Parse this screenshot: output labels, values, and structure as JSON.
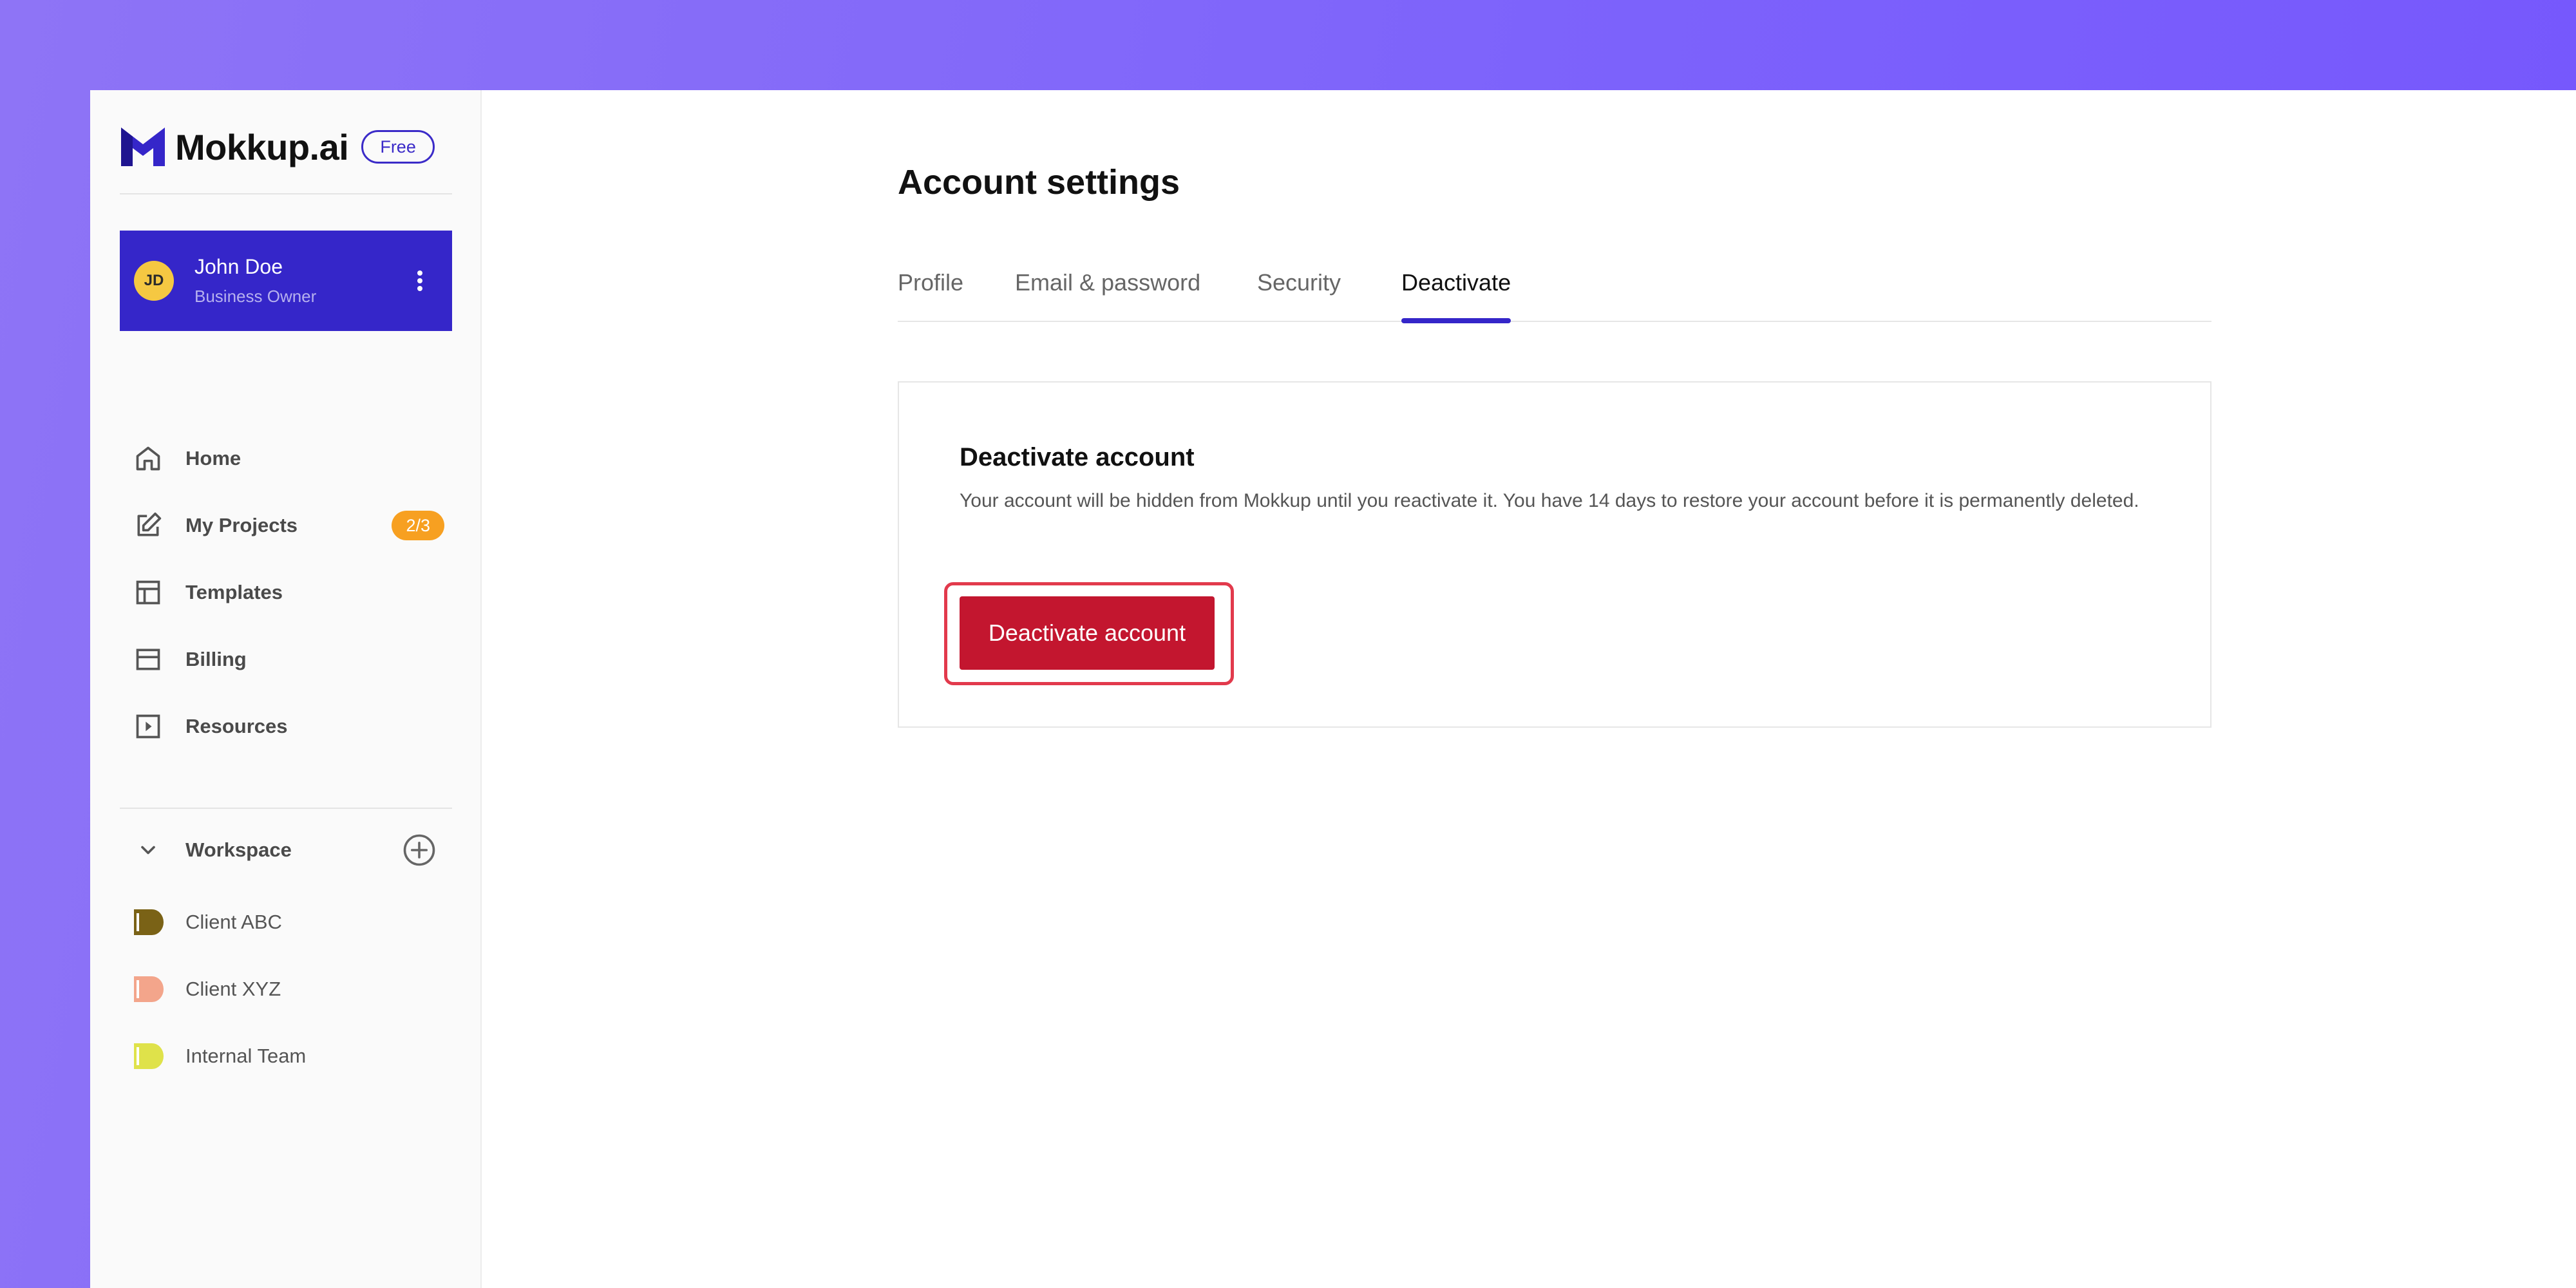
{
  "brand": {
    "name": "Mokkup.ai",
    "plan": "Free",
    "accent": "#3526c9"
  },
  "user": {
    "initials": "JD",
    "name": "John Doe",
    "role": "Business Owner"
  },
  "nav": [
    {
      "label": "Home",
      "icon": "home-icon"
    },
    {
      "label": "My Projects",
      "icon": "edit-icon",
      "badge": "2/3"
    },
    {
      "label": "Templates",
      "icon": "layout-icon"
    },
    {
      "label": "Billing",
      "icon": "card-icon"
    },
    {
      "label": "Resources",
      "icon": "play-icon"
    }
  ],
  "workspace": {
    "label": "Workspace",
    "items": [
      {
        "name": "Client ABC",
        "color": "#7a6216"
      },
      {
        "name": "Client XYZ",
        "color": "#f3a58b"
      },
      {
        "name": "Internal Team",
        "color": "#dfe24a"
      }
    ]
  },
  "page": {
    "title": "Account settings",
    "tabs": [
      "Profile",
      "Email & password",
      "Security",
      "Deactivate"
    ],
    "active_tab": "Deactivate"
  },
  "deactivate": {
    "title": "Deactivate account",
    "description": "Your account will be hidden from Mokkup until you reactivate it. You have 14 days to restore your account before it is permanently deleted.",
    "button_label": "Deactivate account",
    "button_color": "#c3162f"
  }
}
